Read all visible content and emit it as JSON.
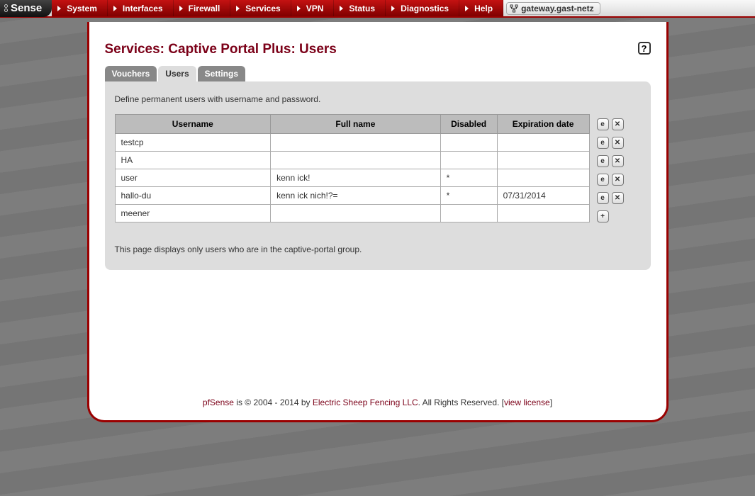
{
  "logo_text": "Sense",
  "menu": [
    "System",
    "Interfaces",
    "Firewall",
    "Services",
    "VPN",
    "Status",
    "Diagnostics",
    "Help"
  ],
  "gateway_label": "gateway.gast-netz",
  "page_title": "Services: Captive Portal Plus: Users",
  "tabs": [
    {
      "label": "Vouchers",
      "active": false
    },
    {
      "label": "Users",
      "active": true
    },
    {
      "label": "Settings",
      "active": false
    }
  ],
  "panel_desc": "Define permanent users with username and password.",
  "columns": {
    "username": "Username",
    "fullname": "Full name",
    "disabled": "Disabled",
    "expiration": "Expiration date"
  },
  "rows": [
    {
      "username": "testcp",
      "fullname": "",
      "disabled": "",
      "expiration": ""
    },
    {
      "username": "HA",
      "fullname": "",
      "disabled": "",
      "expiration": ""
    },
    {
      "username": "user",
      "fullname": "kenn ick!",
      "disabled": "*",
      "expiration": ""
    },
    {
      "username": "hallo-du",
      "fullname": "kenn ick nich!?=",
      "disabled": "*",
      "expiration": "07/31/2014"
    },
    {
      "username": "meener",
      "fullname": "",
      "disabled": "",
      "expiration": ""
    }
  ],
  "panel_note": "This page displays only users who are in the captive-portal group.",
  "footer": {
    "brand": "pfSense",
    "text_mid": " is © 2004 - 2014 by ",
    "company": "Electric Sheep Fencing LLC",
    "text_after": ". All Rights Reserved. [",
    "license": "view license",
    "text_end": "]"
  }
}
